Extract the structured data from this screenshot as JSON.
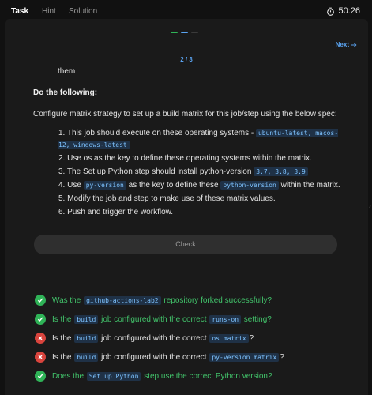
{
  "tabs": [
    {
      "label": "Task"
    },
    {
      "label": "Hint"
    },
    {
      "label": "Solution"
    }
  ],
  "timer": "50:26",
  "pager": {
    "indicator": "2 / 3",
    "next_label": "Next"
  },
  "pager_dots": [
    "#2fb357",
    "#5aa3f0",
    "#3a3a3a"
  ],
  "content": {
    "them": "them",
    "heading": "Do the following:",
    "intro": "Configure matrix strategy to set up a build matrix for this job/step using the below spec:",
    "steps": [
      {
        "num": "1.",
        "pre": "This job should execute on these operating systems - ",
        "code": "ubuntu-latest, macos-12, windows-latest",
        "post": ""
      },
      {
        "num": "2.",
        "pre": "Use os as the key to define these operating systems within the matrix.",
        "code": "",
        "post": ""
      },
      {
        "num": "3.",
        "pre": "The Set up Python step should install python-version ",
        "code": "3.7, 3.8, 3.9",
        "post": ""
      },
      {
        "num": "4.",
        "pre": "Use ",
        "code": "py-version",
        "mid": " as the key to define these ",
        "code2": "python-version",
        "post": " within the matrix."
      },
      {
        "num": "5.",
        "pre": "Modify the job and step to make use of these matrix values.",
        "code": "",
        "post": ""
      },
      {
        "num": "6.",
        "pre": "Push and trigger the workflow.",
        "code": "",
        "post": ""
      }
    ]
  },
  "check_label": "Check",
  "results": [
    {
      "status": "ok",
      "pre": "Was the ",
      "code": "github-actions-lab2",
      "post": " repository forked successfully?"
    },
    {
      "status": "ok",
      "pre": "Is the ",
      "code": "build",
      "mid": " job configured with the correct ",
      "code2": "runs-on",
      "post": " setting?"
    },
    {
      "status": "fail",
      "pre": "Is the ",
      "code": "build",
      "mid": " job configured with the correct ",
      "code2": "os matrix",
      "post": "?"
    },
    {
      "status": "fail",
      "pre": "Is the ",
      "code": "build",
      "mid": " job configured with the correct ",
      "code2": "py-version matrix",
      "post": "?"
    },
    {
      "status": "ok",
      "pre": "Does the ",
      "code": "Set up Python",
      "post": " step use the correct Python version?"
    }
  ]
}
